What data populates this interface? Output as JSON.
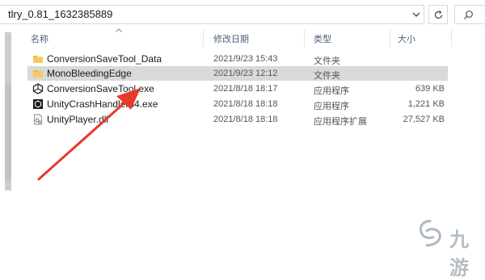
{
  "address_bar": {
    "path": "tlry_0.81_1632385889"
  },
  "search": {
    "placeholder": ""
  },
  "columns": {
    "name": "名称",
    "date": "修改日期",
    "type": "类型",
    "size": "大小"
  },
  "files": [
    {
      "name": "ConversionSaveTool_Data",
      "date": "2021/9/23 15:43",
      "type": "文件夹",
      "size": "",
      "icon": "folder-icon",
      "selected": false
    },
    {
      "name": "MonoBleedingEdge",
      "date": "2021/9/23 12:12",
      "type": "文件夹",
      "size": "",
      "icon": "folder-icon",
      "selected": true
    },
    {
      "name": "ConversionSaveTool.exe",
      "date": "2021/8/18 18:17",
      "type": "应用程序",
      "size": "639 KB",
      "icon": "unity-app-icon",
      "selected": false
    },
    {
      "name": "UnityCrashHandler64.exe",
      "date": "2021/8/18 18:18",
      "type": "应用程序",
      "size": "1,221 KB",
      "icon": "crash-handler-icon",
      "selected": false
    },
    {
      "name": "UnityPlayer.dll",
      "date": "2021/8/18 18:18",
      "type": "应用程序扩展",
      "size": "27,527 KB",
      "icon": "dll-file-icon",
      "selected": false
    }
  ],
  "annotation": {
    "color": "#e8392d"
  },
  "watermark": {
    "text": "九游"
  }
}
